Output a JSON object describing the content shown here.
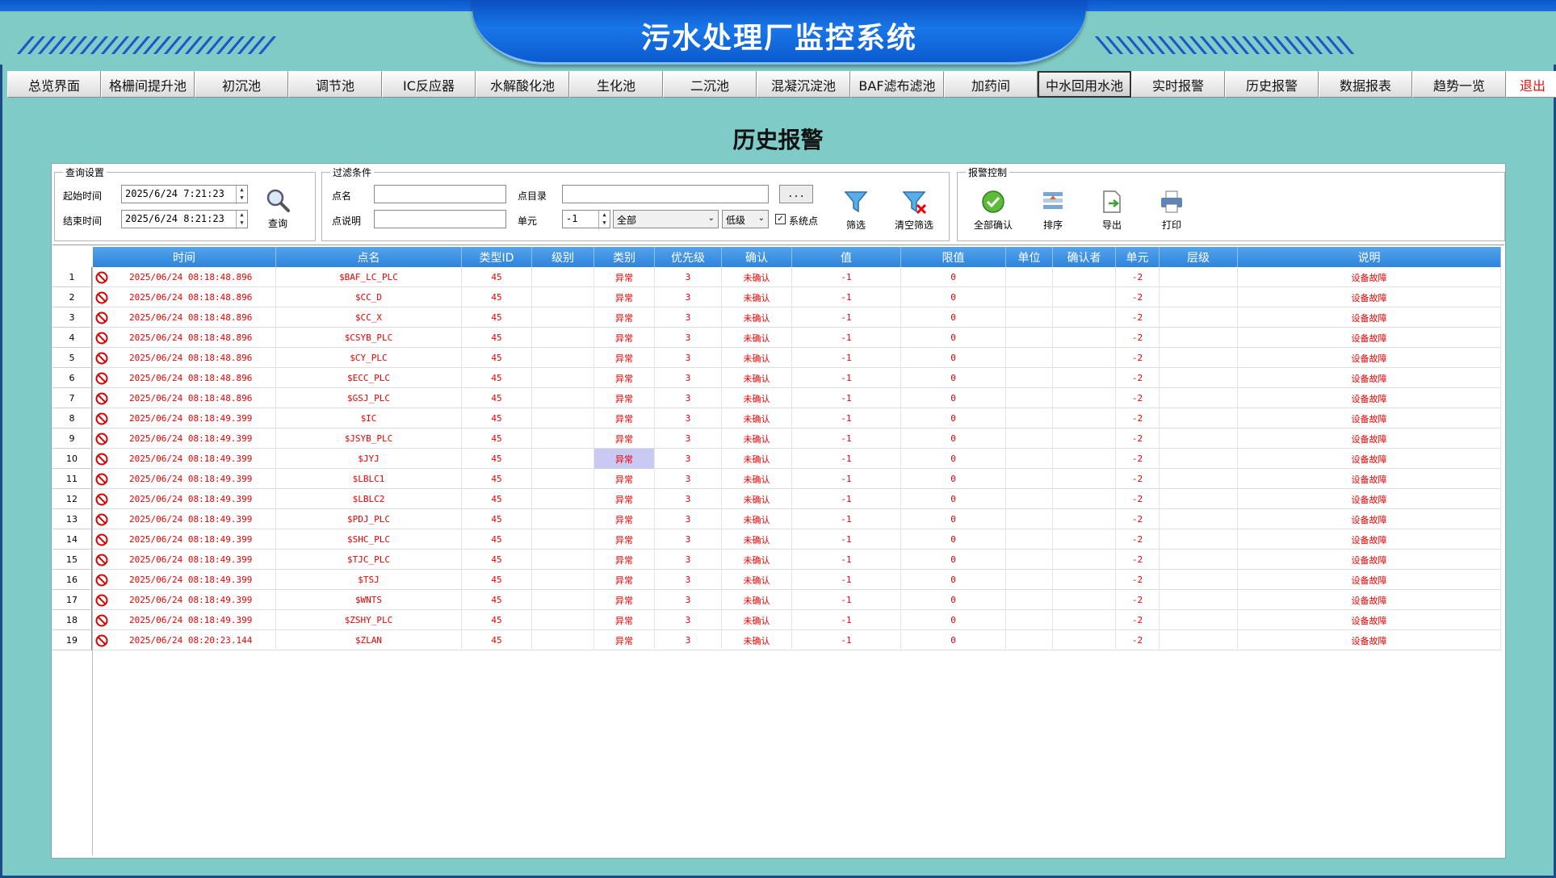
{
  "header": {
    "title": "污水处理厂监控系统"
  },
  "nav": {
    "items": [
      "总览界面",
      "格栅间提升池",
      "初沉池",
      "调节池",
      "IC反应器",
      "水解酸化池",
      "生化池",
      "二沉池",
      "混凝沉淀池",
      "BAF滤布滤池",
      "加药间",
      "中水回用水池",
      "实时报警",
      "历史报警",
      "数据报表",
      "趋势一览",
      "退出"
    ],
    "active": "中水回用水池"
  },
  "page": {
    "title": "历史报警"
  },
  "query": {
    "group_title": "查询设置",
    "start_label": "起始时间",
    "start_value": "2025/6/24  7:21:23",
    "end_label": "结束时间",
    "end_value": "2025/6/24  8:21:23",
    "query_button": "查询"
  },
  "filter": {
    "group_title": "过滤条件",
    "point_name_label": "点名",
    "point_name_value": "",
    "point_desc_label": "点说明",
    "point_desc_value": "",
    "point_dir_label": "点目录",
    "point_dir_value": "",
    "browse_button": "...",
    "unit_label": "单元",
    "unit_value": "-1",
    "scope_value": "全部",
    "level_value": "低级",
    "system_point_label": "系统点",
    "system_point_checked": true,
    "filter_button": "筛选",
    "clear_filter_button": "清空筛选"
  },
  "alarm_control": {
    "group_title": "报警控制",
    "confirm_all": "全部确认",
    "sort": "排序",
    "export": "导出",
    "print": "打印"
  },
  "table": {
    "columns": [
      "时间",
      "点名",
      "类型ID",
      "级别",
      "类别",
      "优先级",
      "确认",
      "值",
      "限值",
      "单位",
      "确认者",
      "单元",
      "层级",
      "说明"
    ],
    "rows": [
      {
        "n": "1",
        "time": "2025/06/24 08:18:48.896",
        "name": "$BAF_LC_PLC",
        "type_id": "45",
        "level": "",
        "category": "异常",
        "priority": "3",
        "confirm": "未确认",
        "value": "-1",
        "limit": "0",
        "unit": "",
        "confirmer": "",
        "unit_no": "-2",
        "tier": "",
        "desc": "设备故障"
      },
      {
        "n": "2",
        "time": "2025/06/24 08:18:48.896",
        "name": "$CC_D",
        "type_id": "45",
        "level": "",
        "category": "异常",
        "priority": "3",
        "confirm": "未确认",
        "value": "-1",
        "limit": "0",
        "unit": "",
        "confirmer": "",
        "unit_no": "-2",
        "tier": "",
        "desc": "设备故障"
      },
      {
        "n": "3",
        "time": "2025/06/24 08:18:48.896",
        "name": "$CC_X",
        "type_id": "45",
        "level": "",
        "category": "异常",
        "priority": "3",
        "confirm": "未确认",
        "value": "-1",
        "limit": "0",
        "unit": "",
        "confirmer": "",
        "unit_no": "-2",
        "tier": "",
        "desc": "设备故障"
      },
      {
        "n": "4",
        "time": "2025/06/24 08:18:48.896",
        "name": "$CSYB_PLC",
        "type_id": "45",
        "level": "",
        "category": "异常",
        "priority": "3",
        "confirm": "未确认",
        "value": "-1",
        "limit": "0",
        "unit": "",
        "confirmer": "",
        "unit_no": "-2",
        "tier": "",
        "desc": "设备故障"
      },
      {
        "n": "5",
        "time": "2025/06/24 08:18:48.896",
        "name": "$CY_PLC",
        "type_id": "45",
        "level": "",
        "category": "异常",
        "priority": "3",
        "confirm": "未确认",
        "value": "-1",
        "limit": "0",
        "unit": "",
        "confirmer": "",
        "unit_no": "-2",
        "tier": "",
        "desc": "设备故障"
      },
      {
        "n": "6",
        "time": "2025/06/24 08:18:48.896",
        "name": "$ECC_PLC",
        "type_id": "45",
        "level": "",
        "category": "异常",
        "priority": "3",
        "confirm": "未确认",
        "value": "-1",
        "limit": "0",
        "unit": "",
        "confirmer": "",
        "unit_no": "-2",
        "tier": "",
        "desc": "设备故障"
      },
      {
        "n": "7",
        "time": "2025/06/24 08:18:48.896",
        "name": "$GSJ_PLC",
        "type_id": "45",
        "level": "",
        "category": "异常",
        "priority": "3",
        "confirm": "未确认",
        "value": "-1",
        "limit": "0",
        "unit": "",
        "confirmer": "",
        "unit_no": "-2",
        "tier": "",
        "desc": "设备故障"
      },
      {
        "n": "8",
        "time": "2025/06/24 08:18:49.399",
        "name": "$IC",
        "type_id": "45",
        "level": "",
        "category": "异常",
        "priority": "3",
        "confirm": "未确认",
        "value": "-1",
        "limit": "0",
        "unit": "",
        "confirmer": "",
        "unit_no": "-2",
        "tier": "",
        "desc": "设备故障"
      },
      {
        "n": "9",
        "time": "2025/06/24 08:18:49.399",
        "name": "$JSYB_PLC",
        "type_id": "45",
        "level": "",
        "category": "异常",
        "priority": "3",
        "confirm": "未确认",
        "value": "-1",
        "limit": "0",
        "unit": "",
        "confirmer": "",
        "unit_no": "-2",
        "tier": "",
        "desc": "设备故障"
      },
      {
        "n": "10",
        "time": "2025/06/24 08:18:49.399",
        "name": "$JYJ",
        "type_id": "45",
        "level": "",
        "category": "异常",
        "priority": "3",
        "confirm": "未确认",
        "value": "-1",
        "limit": "0",
        "unit": "",
        "confirmer": "",
        "unit_no": "-2",
        "tier": "",
        "desc": "设备故障",
        "selected": true
      },
      {
        "n": "11",
        "time": "2025/06/24 08:18:49.399",
        "name": "$LBLC1",
        "type_id": "45",
        "level": "",
        "category": "异常",
        "priority": "3",
        "confirm": "未确认",
        "value": "-1",
        "limit": "0",
        "unit": "",
        "confirmer": "",
        "unit_no": "-2",
        "tier": "",
        "desc": "设备故障"
      },
      {
        "n": "12",
        "time": "2025/06/24 08:18:49.399",
        "name": "$LBLC2",
        "type_id": "45",
        "level": "",
        "category": "异常",
        "priority": "3",
        "confirm": "未确认",
        "value": "-1",
        "limit": "0",
        "unit": "",
        "confirmer": "",
        "unit_no": "-2",
        "tier": "",
        "desc": "设备故障"
      },
      {
        "n": "13",
        "time": "2025/06/24 08:18:49.399",
        "name": "$PDJ_PLC",
        "type_id": "45",
        "level": "",
        "category": "异常",
        "priority": "3",
        "confirm": "未确认",
        "value": "-1",
        "limit": "0",
        "unit": "",
        "confirmer": "",
        "unit_no": "-2",
        "tier": "",
        "desc": "设备故障"
      },
      {
        "n": "14",
        "time": "2025/06/24 08:18:49.399",
        "name": "$SHC_PLC",
        "type_id": "45",
        "level": "",
        "category": "异常",
        "priority": "3",
        "confirm": "未确认",
        "value": "-1",
        "limit": "0",
        "unit": "",
        "confirmer": "",
        "unit_no": "-2",
        "tier": "",
        "desc": "设备故障"
      },
      {
        "n": "15",
        "time": "2025/06/24 08:18:49.399",
        "name": "$TJC_PLC",
        "type_id": "45",
        "level": "",
        "category": "异常",
        "priority": "3",
        "confirm": "未确认",
        "value": "-1",
        "limit": "0",
        "unit": "",
        "confirmer": "",
        "unit_no": "-2",
        "tier": "",
        "desc": "设备故障"
      },
      {
        "n": "16",
        "time": "2025/06/24 08:18:49.399",
        "name": "$TSJ",
        "type_id": "45",
        "level": "",
        "category": "异常",
        "priority": "3",
        "confirm": "未确认",
        "value": "-1",
        "limit": "0",
        "unit": "",
        "confirmer": "",
        "unit_no": "-2",
        "tier": "",
        "desc": "设备故障"
      },
      {
        "n": "17",
        "time": "2025/06/24 08:18:49.399",
        "name": "$WNTS",
        "type_id": "45",
        "level": "",
        "category": "异常",
        "priority": "3",
        "confirm": "未确认",
        "value": "-1",
        "limit": "0",
        "unit": "",
        "confirmer": "",
        "unit_no": "-2",
        "tier": "",
        "desc": "设备故障"
      },
      {
        "n": "18",
        "time": "2025/06/24 08:18:49.399",
        "name": "$ZSHY_PLC",
        "type_id": "45",
        "level": "",
        "category": "异常",
        "priority": "3",
        "confirm": "未确认",
        "value": "-1",
        "limit": "0",
        "unit": "",
        "confirmer": "",
        "unit_no": "-2",
        "tier": "",
        "desc": "设备故障"
      },
      {
        "n": "19",
        "time": "2025/06/24 08:20:23.144",
        "name": "$ZLAN",
        "type_id": "45",
        "level": "",
        "category": "异常",
        "priority": "3",
        "confirm": "未确认",
        "value": "-1",
        "limit": "0",
        "unit": "",
        "confirmer": "",
        "unit_no": "-2",
        "tier": "",
        "desc": "设备故障"
      }
    ]
  },
  "colors": {
    "background": "#7fcbc7",
    "header_blue": "#1976e8",
    "grid_header": "#2d84dd",
    "alarm_text": "#e00000",
    "exit_text": "#e01010"
  },
  "icons": {
    "alarm_row": "no-entry-icon",
    "query": "magnifier-icon",
    "filter": "funnel-icon",
    "clear_filter": "funnel-x-icon",
    "confirm_all": "check-circle-icon",
    "sort": "sort-list-icon",
    "export": "export-doc-icon",
    "print": "printer-icon"
  }
}
